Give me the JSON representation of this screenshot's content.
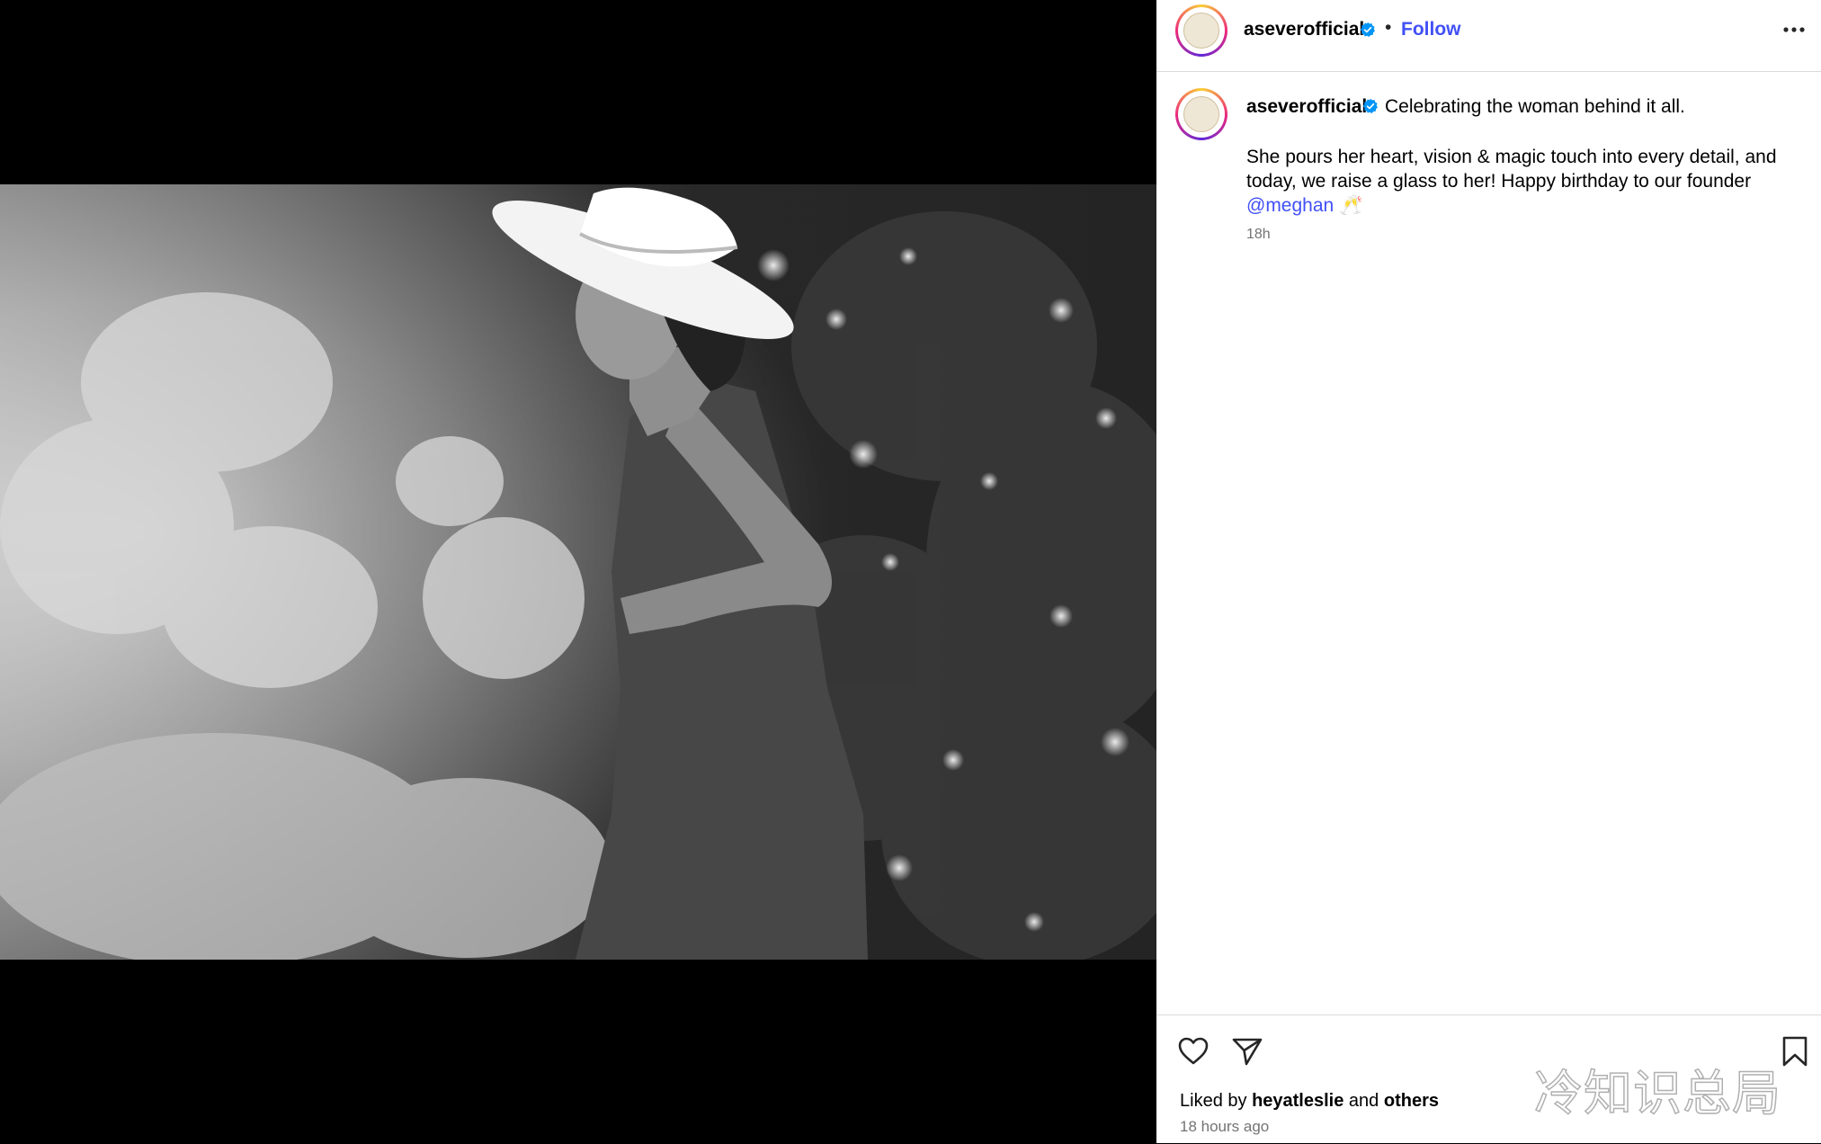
{
  "post": {
    "username": "aseverofficial",
    "separator": "•",
    "follow_label": "Follow",
    "more_icon": "more-horizontal-icon",
    "verified_icon": "verified-badge-icon",
    "verified_color": "#0095f6",
    "follow_color": "#4150f7"
  },
  "caption": {
    "username": "aseverofficial",
    "first_line": "Celebrating the woman behind it all.",
    "body_text": "She pours her heart, vision & magic touch into every detail, and today, we raise a glass to her! Happy birthday to our founder",
    "mention": "@meghan",
    "emoji": "🥂",
    "time": "18h"
  },
  "photo": {
    "description_icon": "black-and-white-photo-woman-in-hat"
  },
  "actions": {
    "like_icon": "heart-icon",
    "share_icon": "send-icon",
    "save_icon": "bookmark-icon",
    "liked_by_prefix": "Liked by",
    "liked_by_user": "heyatleslie",
    "liked_by_and": "and",
    "liked_by_others": "others",
    "post_age": "18 hours ago"
  },
  "watermark": {
    "text": "冷知识总局"
  }
}
